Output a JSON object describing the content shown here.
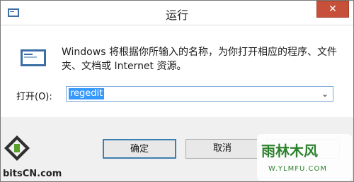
{
  "window": {
    "title": "运行",
    "close_symbol": "✕"
  },
  "content": {
    "description": "Windows 将根据你所输入的名称，为你打开相应的程序、文件夹、文档或 Internet 资源。",
    "open_label": "打开(O):",
    "open_value": "regedit",
    "dropdown_symbol": "⌄"
  },
  "buttons": {
    "ok": "确定",
    "cancel": "取消",
    "browse": ""
  },
  "watermarks": {
    "left": "bitsCN.com",
    "right_top": "雨林木风",
    "right_bottom": "W.YLMFU.COM"
  },
  "icons": {
    "title": "run-app-icon",
    "content": "run-dialog-icon",
    "close": "close-icon",
    "dropdown": "chevron-down-icon"
  },
  "colors": {
    "close_button": "#c7503a",
    "selection": "#3399ff",
    "watermark_green": "#1e7a1e"
  }
}
